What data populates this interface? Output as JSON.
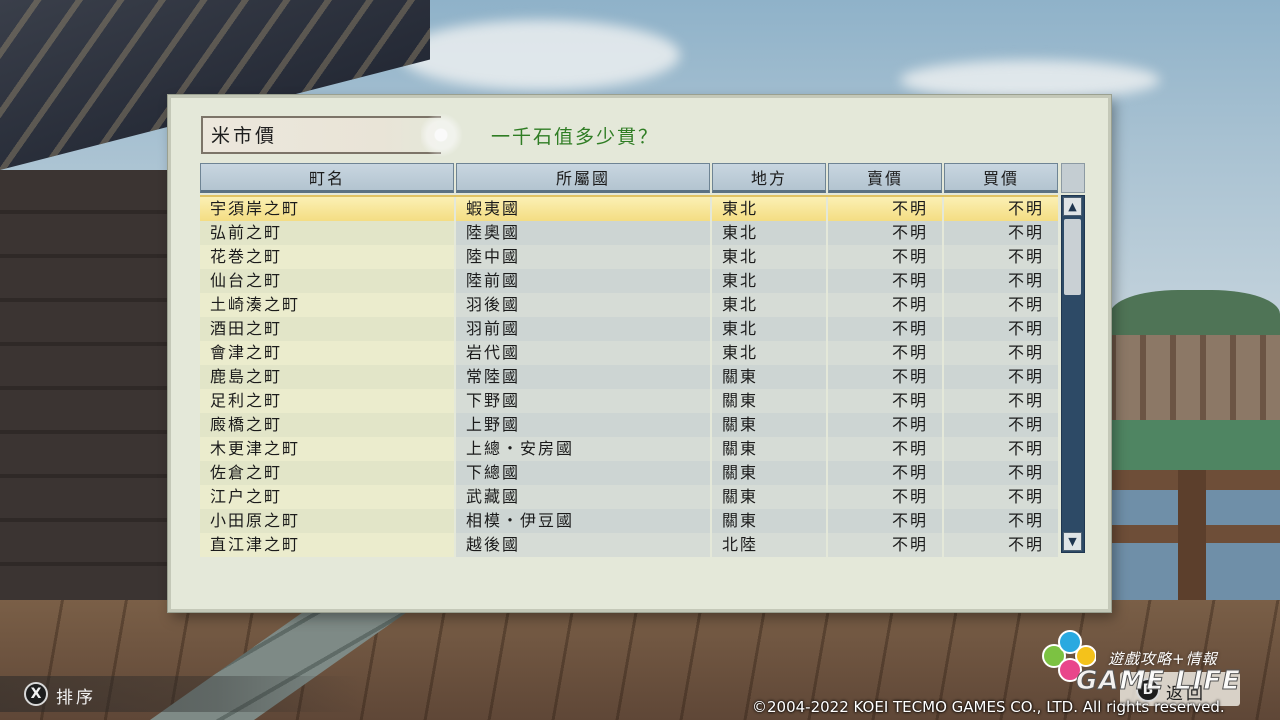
{
  "dialog": {
    "title": "米市價",
    "subtitle": "一千石值多少貫？"
  },
  "table": {
    "headers": [
      "町名",
      "所屬國",
      "地方",
      "賣價",
      "買價"
    ],
    "rows": [
      [
        "宇須岸之町",
        "蝦夷國",
        "東北",
        "不明",
        "不明"
      ],
      [
        "弘前之町",
        "陸奧國",
        "東北",
        "不明",
        "不明"
      ],
      [
        "花巻之町",
        "陸中國",
        "東北",
        "不明",
        "不明"
      ],
      [
        "仙台之町",
        "陸前國",
        "東北",
        "不明",
        "不明"
      ],
      [
        "土崎湊之町",
        "羽後國",
        "東北",
        "不明",
        "不明"
      ],
      [
        "酒田之町",
        "羽前國",
        "東北",
        "不明",
        "不明"
      ],
      [
        "會津之町",
        "岩代國",
        "東北",
        "不明",
        "不明"
      ],
      [
        "鹿島之町",
        "常陸國",
        "關東",
        "不明",
        "不明"
      ],
      [
        "足利之町",
        "下野國",
        "關東",
        "不明",
        "不明"
      ],
      [
        "廄橋之町",
        "上野國",
        "關東",
        "不明",
        "不明"
      ],
      [
        "木更津之町",
        "上總・安房國",
        "關東",
        "不明",
        "不明"
      ],
      [
        "佐倉之町",
        "下總國",
        "關東",
        "不明",
        "不明"
      ],
      [
        "江户之町",
        "武藏國",
        "關東",
        "不明",
        "不明"
      ],
      [
        "小田原之町",
        "相模・伊豆國",
        "關東",
        "不明",
        "不明"
      ],
      [
        "直江津之町",
        "越後國",
        "北陸",
        "不明",
        "不明"
      ]
    ],
    "selected_row": 0
  },
  "scrollbar": {
    "up_icon": "▲",
    "down_icon": "▼"
  },
  "footer": {
    "sort_button_glyph": "X",
    "sort_label": "排序",
    "back_button_glyph": "B",
    "back_label": "返回",
    "watermark_tagline": "遊戲攻略+情報",
    "watermark_logo": "GAME LIFE",
    "copyright": "©2004-2022 KOEI TECMO GAMES CO., LTD. All rights reserved."
  }
}
